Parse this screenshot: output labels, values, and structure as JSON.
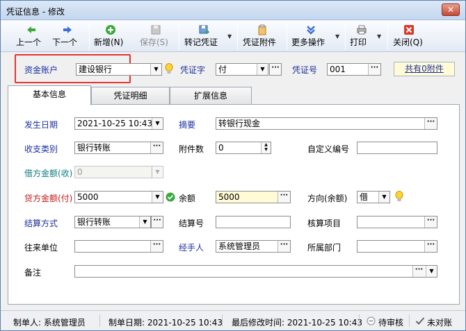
{
  "window": {
    "title": "凭证信息 - 修改",
    "close_glyph": "✕"
  },
  "toolbar": {
    "prev": {
      "label": "上一个",
      "icon": "arrow-left-icon"
    },
    "next": {
      "label": "下一个",
      "icon": "arrow-right-icon"
    },
    "new": {
      "label": "新增(N)",
      "icon": "plus-circle-icon"
    },
    "save": {
      "label": "保存(S)",
      "icon": "floppy-icon"
    },
    "transfer": {
      "label": "转记凭证",
      "icon": "floppy-arrow-icon"
    },
    "attach": {
      "label": "凭证附件",
      "icon": "clipboard-icon"
    },
    "more": {
      "label": "更多操作",
      "icon": "double-chevron-down-icon"
    },
    "print": {
      "label": "打印",
      "icon": "printer-icon"
    },
    "close": {
      "label": "关闭(Q)",
      "icon": "close-red-icon"
    },
    "drop_glyph": "▼"
  },
  "header": {
    "account_label": "资金账户",
    "account_value": "建设银行",
    "voucher_type_label": "凭证字",
    "voucher_type_value": "付",
    "voucher_no_label": "凭证号",
    "voucher_no_value": "001",
    "attachments_link": "共有0附件"
  },
  "tabs": [
    "基本信息",
    "凭证明细",
    "扩展信息"
  ],
  "form": {
    "date_label": "发生日期",
    "date_value": "2021-10-25 10:43",
    "summary_label": "摘要",
    "summary_value": "转银行现金",
    "category_label": "收支类别",
    "category_value": "银行转账",
    "attach_count_label": "附件数",
    "attach_count_value": "0",
    "custom_no_label": "自定义编号",
    "custom_no_value": "",
    "debit_label": "借方金额(收)",
    "debit_value": "0",
    "credit_label": "贷方金额(付)",
    "credit_value": "5000",
    "balance_label": "余额",
    "balance_value": "5000",
    "direction_label": "方向(余额)",
    "direction_value": "借",
    "settle_label": "结算方式",
    "settle_value": "银行转账",
    "settle_no_label": "结算号",
    "settle_no_value": "",
    "project_label": "核算项目",
    "project_value": "",
    "partner_label": "往来单位",
    "partner_value": "",
    "handler_label": "经手人",
    "handler_value": "系统管理员",
    "dept_label": "所属部门",
    "dept_value": "",
    "note_label": "备注",
    "note_value": ""
  },
  "status": {
    "maker": "制单人: 系统管理员",
    "made_date": "制单日期: 2021-10-25 10:43",
    "modified": "最后修改时间: 2021-10-25 10:43",
    "review": "待审核",
    "reconcile": "未对账"
  },
  "glyphs": {
    "ellipsis": "···",
    "dropdown": "▼",
    "spin_up": "▲",
    "spin_down": "▼"
  },
  "colors": {
    "highlight_box": "#e53333",
    "label_blue": "#1d2fa0",
    "label_red": "#c01818",
    "label_teal": "#0f7a80"
  }
}
